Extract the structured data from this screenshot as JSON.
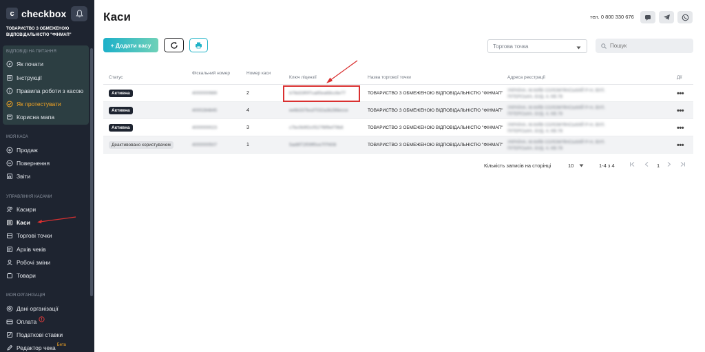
{
  "sidebar": {
    "brand": "checkbox",
    "brand_logo": "c",
    "org_name": "ТОВАРИСТВО З ОБМЕЖЕНОЮ ВІДПОВІДАЛЬНІСТЮ \"ФІНМАП\"",
    "sections": {
      "help": "ВІДПОВІДІ НА ПИТАННЯ",
      "my_cash": "МОЯ КАСА",
      "manage": "УПРАВЛІННЯ КАСАМИ",
      "org": "МОЯ ОРГАНІЗАЦІЯ"
    },
    "help_items": [
      "Як почати",
      "Інструкції",
      "Правила роботи з касою",
      "Як протестувати",
      "Корисна мапа"
    ],
    "cash_items": [
      "Продаж",
      "Повернення",
      "Звіти"
    ],
    "manage_items": [
      "Касири",
      "Каси",
      "Торгові точки",
      "Архів чеків",
      "Робочі зміни",
      "Товари"
    ],
    "org_items": [
      "Дані організації",
      "Оплата",
      "Податкові ставки",
      "Редактор чека"
    ],
    "beta_label": "Бета"
  },
  "header": {
    "title": "Каси",
    "phone": "тел. 0 800 330 676"
  },
  "toolbar": {
    "add_label": "+ Додати касу",
    "point_select_placeholder": "Торгова точка",
    "search_placeholder": "Пошук"
  },
  "table": {
    "columns": [
      "Статус",
      "Фіскальний номер",
      "Номер каси",
      "Ключ ліцензії",
      "Назва торгової точки",
      "Адреса реєстрації",
      "Дії"
    ],
    "rows": [
      {
        "status": "Активна",
        "fiscal": "4000000989",
        "number": "2",
        "key": "b78d33f0f7ca85ea68cc6e77",
        "point": "ТОВАРИСТВО З ОБМЕЖЕНОЮ ВІДПОВІДАЛЬНІСТЮ \"ФІНМАП\"",
        "address": "УКРАЇНА, М.КИЇВ СОЛОМ'ЯНСЬКИЙ Р-Н, ВУЛ. ПІТЕРСЬКА, БУД. 4, КВ.78"
      },
      {
        "status": "Активна",
        "fiscal": "4000284845",
        "number": "4",
        "key": "ee6b337bcd7032a3b286ecce",
        "point": "ТОВАРИСТВО З ОБМЕЖЕНОЮ ВІДПОВІДАЛЬНІСТЮ \"ФІНМАП\"",
        "address": "УКРАЇНА, М.КИЇВ СОЛОМ'ЯНСЬКИЙ Р-Н, ВУЛ. ПІТЕРСЬКА, БУД. 4, КВ.78"
      },
      {
        "status": "Активна",
        "fiscal": "4000000023",
        "number": "3",
        "key": "c7bc0b9f2c0527f8f9ef79b8",
        "point": "ТОВАРИСТВО З ОБМЕЖЕНОЮ ВІДПОВІДАЛЬНІСТЮ \"ФІНМАП\"",
        "address": "УКРАЇНА, М.КИЇВ СОЛОМ'ЯНСЬКИЙ Р-Н, ВУЛ. ПІТЕРСЬКА, БУД. 4, КВ.78"
      },
      {
        "status": "Деактивовано користувачем",
        "fiscal": "4000000507",
        "number": "1",
        "key": "5ad8f72f09ff0ce7f7f408",
        "point": "ТОВАРИСТВО З ОБМЕЖЕНОЮ ВІДПОВІДАЛЬНІСТЮ \"ФІНМАП\"",
        "address": "УКРАЇНА, М.КИЇВ СОЛОМ'ЯНСЬКИЙ Р-Н, ВУЛ. ПІТЕРСЬКА, БУД. 4, КВ.78"
      }
    ],
    "actions_glyph": "•••"
  },
  "pagination": {
    "per_page_label": "Кількість записів на сторінці",
    "per_page_value": "10",
    "range": "1-4 з 4",
    "current_page": "1"
  },
  "colors": {
    "sidebar_bg": "#1e2430",
    "accent": "#1cb0c9",
    "annotation_red": "#d93030"
  }
}
